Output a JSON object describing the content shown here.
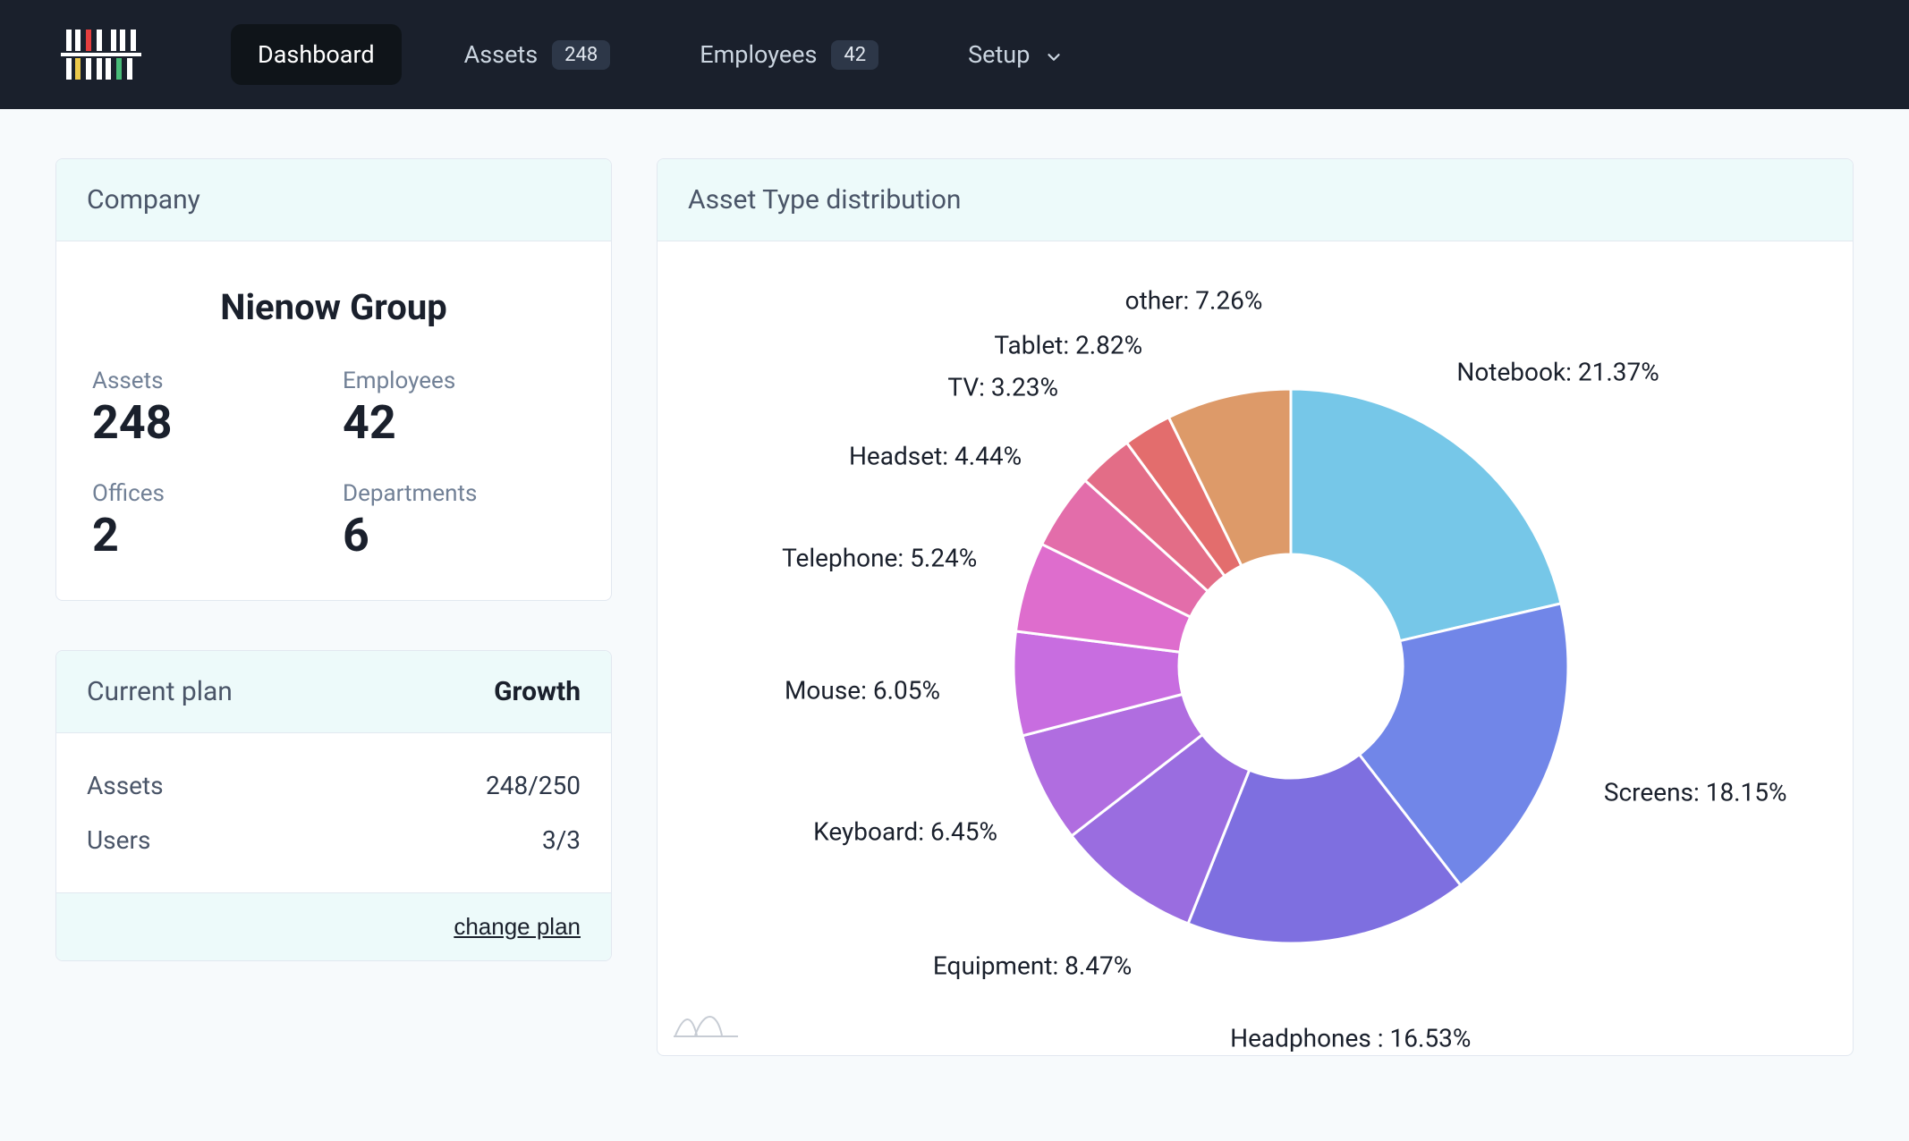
{
  "nav": {
    "items": [
      {
        "label": "Dashboard",
        "active": true
      },
      {
        "label": "Assets",
        "badge": "248"
      },
      {
        "label": "Employees",
        "badge": "42"
      },
      {
        "label": "Setup",
        "dropdown": true
      }
    ]
  },
  "company_card": {
    "header": "Company",
    "name": "Nienow Group",
    "stats": [
      {
        "label": "Assets",
        "value": "248"
      },
      {
        "label": "Employees",
        "value": "42"
      },
      {
        "label": "Offices",
        "value": "2"
      },
      {
        "label": "Departments",
        "value": "6"
      }
    ]
  },
  "plan_card": {
    "header_label": "Current plan",
    "header_value": "Growth",
    "rows": [
      {
        "label": "Assets",
        "value": "248/250"
      },
      {
        "label": "Users",
        "value": "3/3"
      }
    ],
    "change_plan": "change plan"
  },
  "chart_card": {
    "header": "Asset Type distribution"
  },
  "chart_data": {
    "type": "pie",
    "title": "Asset Type distribution",
    "inner_radius_pct": 40,
    "series": [
      {
        "name": "Notebook",
        "value": 21.37,
        "color": "#76c7e8",
        "label": "Notebook: 21.37%"
      },
      {
        "name": "Screens",
        "value": 18.15,
        "color": "#7186e8",
        "label": "Screens: 18.15%"
      },
      {
        "name": "Headphones",
        "value": 16.53,
        "color": "#7e6fe0",
        "label": "Headphones : 16.53%"
      },
      {
        "name": "Equipment",
        "value": 8.47,
        "color": "#9a6de0",
        "label": "Equipment: 8.47%"
      },
      {
        "name": "Keyboard",
        "value": 6.45,
        "color": "#b06de0",
        "label": "Keyboard: 6.45%"
      },
      {
        "name": "Mouse",
        "value": 6.05,
        "color": "#c86de0",
        "label": "Mouse: 6.05%"
      },
      {
        "name": "Telephone",
        "value": 5.24,
        "color": "#de6dcd",
        "label": "Telephone: 5.24%"
      },
      {
        "name": "Headset",
        "value": 4.44,
        "color": "#e36daa",
        "label": "Headset: 4.44%"
      },
      {
        "name": "TV",
        "value": 3.23,
        "color": "#e36d87",
        "label": "TV: 3.23%"
      },
      {
        "name": "Tablet",
        "value": 2.82,
        "color": "#e36d6d",
        "label": "Tablet: 2.82%"
      },
      {
        "name": "other",
        "value": 7.26,
        "color": "#dd9a69",
        "label": "other: 7.26%"
      }
    ]
  }
}
